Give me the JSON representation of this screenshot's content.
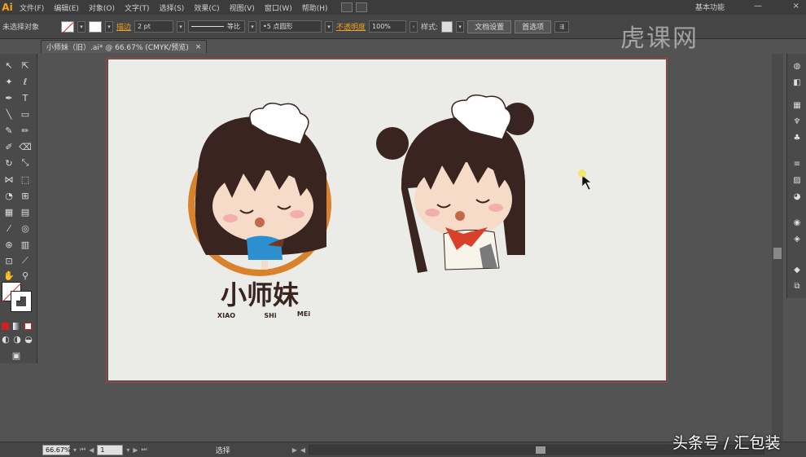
{
  "app": {
    "logo": "Ai"
  },
  "menu": {
    "items": [
      "文件(F)",
      "编辑(E)",
      "对象(O)",
      "文字(T)",
      "选择(S)",
      "效果(C)",
      "视图(V)",
      "窗口(W)",
      "帮助(H)"
    ],
    "workspace": "基本功能",
    "minimize": "—",
    "close": "×"
  },
  "control": {
    "selection_status": "未选择对象",
    "stroke_label": "描边",
    "stroke_weight": "2 pt",
    "stroke_profile": "等比",
    "brush": "5 点圆形",
    "opacity_label": "不透明度",
    "opacity_value": "100%",
    "style_label": "样式:",
    "doc_setup": "文档设置",
    "preferences": "首选项"
  },
  "document": {
    "tab_title": "小师妹（旧）.ai* @ 66.67% (CMYK/预览)",
    "tab_close": "×"
  },
  "artwork": {
    "logo_title": "小师妹",
    "pinyin": [
      "XIAO",
      "SHi",
      "MEi"
    ]
  },
  "status": {
    "zoom": "66.67%",
    "artboard_num": "1",
    "mode": "选择"
  },
  "watermark": {
    "logo": "虎课网",
    "credit": "头条号 / 汇包装"
  },
  "colors": {
    "accent": "#f7a21b",
    "hair": "#3a2420",
    "skin": "#f6dcc8",
    "orange_ring": "#d9822b",
    "artboard_bg": "#ebebe7",
    "scarf": "#d9402a",
    "blue_shirt": "#2c8fd0"
  }
}
